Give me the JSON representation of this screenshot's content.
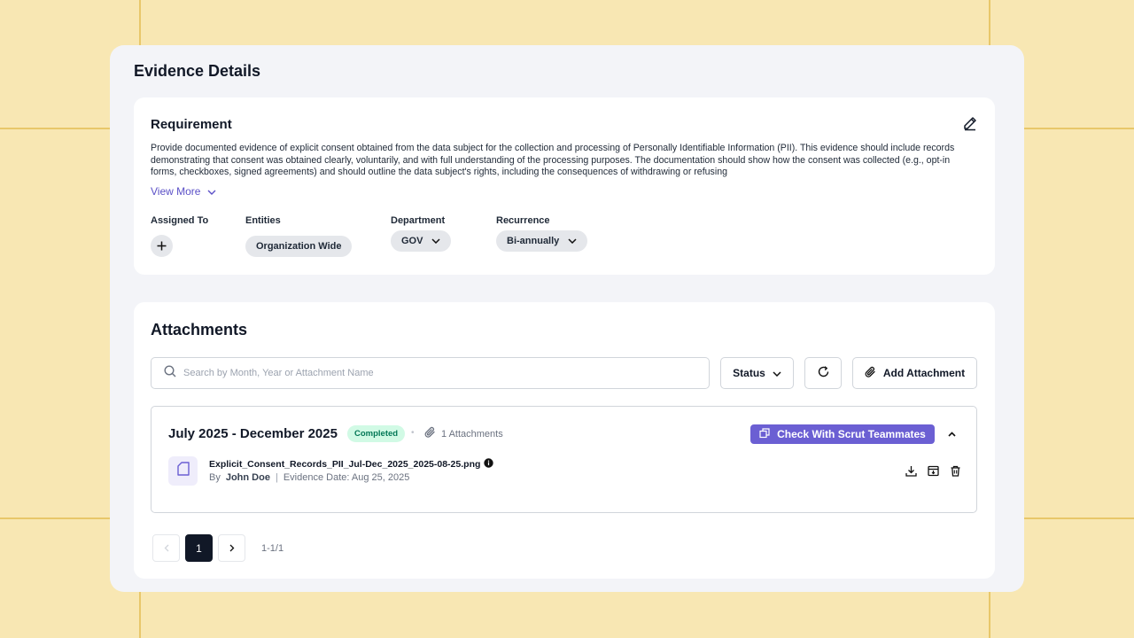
{
  "page": {
    "title": "Evidence Details"
  },
  "requirement": {
    "title": "Requirement",
    "description": "Provide documented evidence of explicit consent obtained from the data subject for the collection and processing of Personally Identifiable Information (PII). This evidence should include records demonstrating that consent was obtained clearly, voluntarily, and with full understanding of the processing purposes. The documentation should show how the consent was collected (e.g., opt-in forms, checkboxes, signed agreements) and should outline the data subject's rights, including the consequences of withdrawing or refusing",
    "view_more_label": "View More",
    "assigned_to_label": "Assigned To",
    "entities_label": "Entities",
    "entities_value": "Organization Wide",
    "department_label": "Department",
    "department_value": "GOV",
    "recurrence_label": "Recurrence",
    "recurrence_value": "Bi-annually"
  },
  "attachments": {
    "title": "Attachments",
    "search_placeholder": "Search by Month, Year or Attachment Name",
    "status_label": "Status",
    "add_label": "Add Attachment",
    "periods": [
      {
        "title": "July 2025 - December 2025",
        "status": "Completed",
        "attachments_count": "1 Attachments",
        "check_label": "Check With Scrut Teammates",
        "files": [
          {
            "name": "Explicit_Consent_Records_PII_Jul-Dec_2025_2025-08-25.png",
            "by_label": "By",
            "author": "John Doe",
            "evidence_date": "Evidence Date: Aug 25, 2025"
          }
        ]
      }
    ]
  },
  "pagination": {
    "current_page": "1",
    "range": "1-1/1"
  },
  "colors": {
    "accent": "#6b5fd3",
    "background": "#f8e7b3",
    "success_bg": "#d1fae5",
    "success_text": "#047857"
  }
}
